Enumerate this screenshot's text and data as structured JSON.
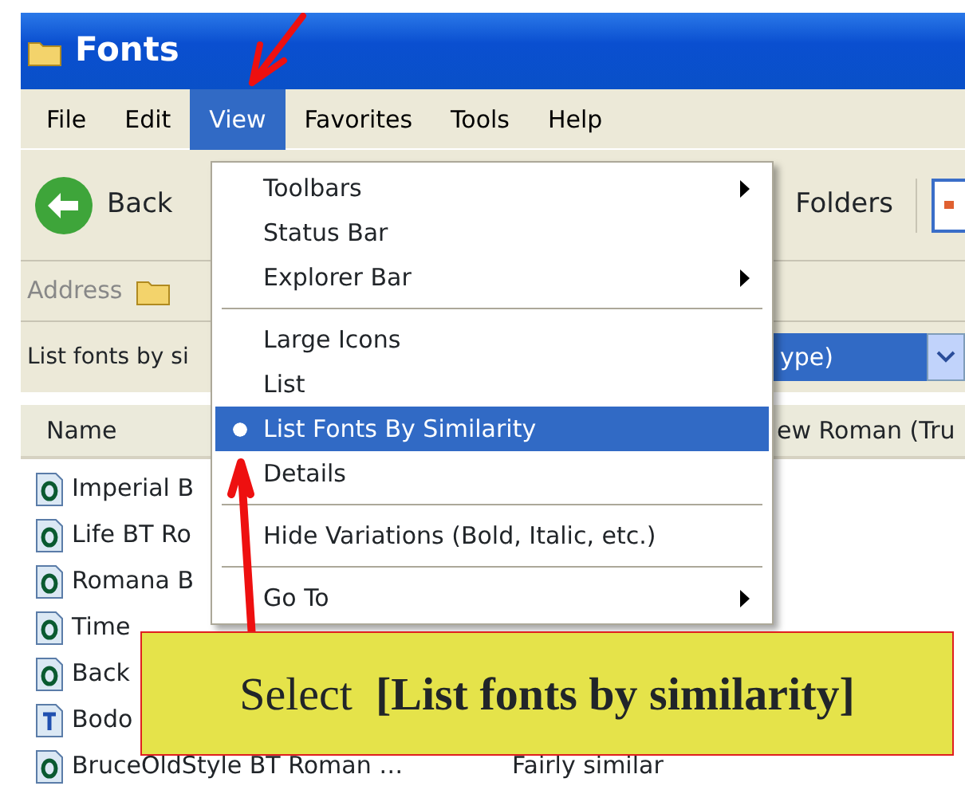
{
  "window": {
    "title": "Fonts"
  },
  "menu_bar": [
    {
      "label": "File",
      "selected": false
    },
    {
      "label": "Edit",
      "selected": false
    },
    {
      "label": "View",
      "selected": true
    },
    {
      "label": "Favorites",
      "selected": false
    },
    {
      "label": "Tools",
      "selected": false
    },
    {
      "label": "Help",
      "selected": false
    }
  ],
  "toolbar": {
    "back": "Back",
    "folders": "Folders"
  },
  "address": {
    "label": "Address"
  },
  "similarity_bar": {
    "label": "List fonts by si",
    "dropdown_value": "ype)"
  },
  "columns": [
    "Name",
    "ew Roman (Tru"
  ],
  "rows": [
    {
      "name": "Imperial B",
      "kind": "opentype"
    },
    {
      "name": "Life BT Ro",
      "kind": "opentype"
    },
    {
      "name": "Romana B",
      "kind": "opentype"
    },
    {
      "name": "Time",
      "kind": "opentype"
    },
    {
      "name": "Back",
      "kind": "opentype"
    },
    {
      "name": "Bodo",
      "kind": "truetype"
    },
    {
      "name": "BruceOldStyle BT Roman …",
      "kind": "opentype",
      "similarity": "Fairly similar"
    }
  ],
  "view_menu": [
    {
      "kind": "item",
      "label": "Toolbars",
      "submenu": true,
      "selected": false,
      "checked": false
    },
    {
      "kind": "item",
      "label": "Status Bar",
      "submenu": false,
      "selected": false,
      "checked": false
    },
    {
      "kind": "item",
      "label": "Explorer Bar",
      "submenu": true,
      "selected": false,
      "checked": false
    },
    {
      "kind": "separator"
    },
    {
      "kind": "item",
      "label": "Large Icons",
      "submenu": false,
      "selected": false,
      "checked": false
    },
    {
      "kind": "item",
      "label": "List",
      "submenu": false,
      "selected": false,
      "checked": false
    },
    {
      "kind": "item",
      "label": "List Fonts By Similarity",
      "submenu": false,
      "selected": true,
      "checked": true
    },
    {
      "kind": "item",
      "label": "Details",
      "submenu": false,
      "selected": false,
      "checked": false
    },
    {
      "kind": "separator"
    },
    {
      "kind": "item",
      "label": "Hide Variations (Bold, Italic, etc.)",
      "submenu": false,
      "selected": false,
      "checked": false
    },
    {
      "kind": "separator"
    },
    {
      "kind": "item",
      "label": "Go To",
      "submenu": true,
      "selected": false,
      "checked": false
    }
  ],
  "callout": "Select  **[List fonts by similarity]**"
}
